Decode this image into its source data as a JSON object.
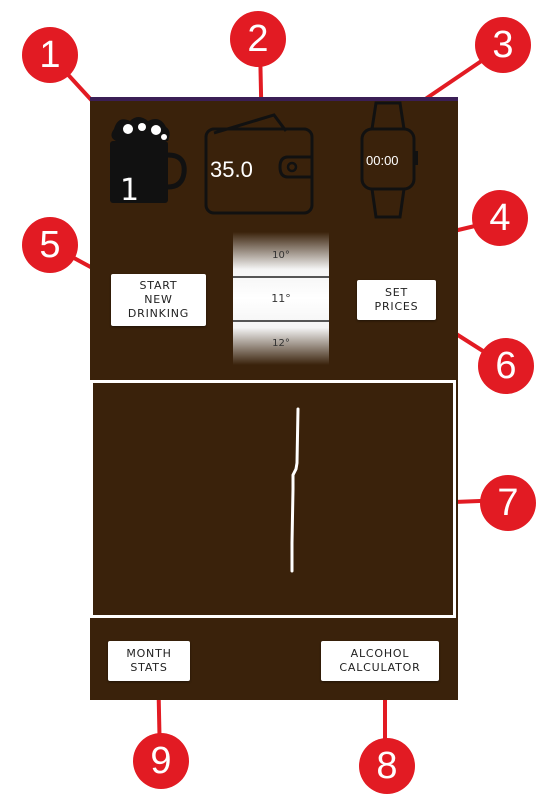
{
  "header": {
    "beer_count": "1",
    "wallet_amount": "35.0",
    "timer": "00:00"
  },
  "buttons": {
    "start_new_drinking": "START\nNEW\nDRINKING",
    "set_prices": "SET\nPRICES",
    "month_stats": "MONTH\nSTATS",
    "alcohol_calculator": "ALCOHOL\nCALCULATOR"
  },
  "picker": {
    "options": [
      "10°",
      "11°",
      "12°"
    ],
    "selected": "11°"
  },
  "callouts": [
    "1",
    "2",
    "3",
    "4",
    "5",
    "6",
    "7",
    "8",
    "9"
  ],
  "colors": {
    "app_background": "#3a220b",
    "status_bar": "#3b1f56",
    "callout": "#e21b23"
  }
}
